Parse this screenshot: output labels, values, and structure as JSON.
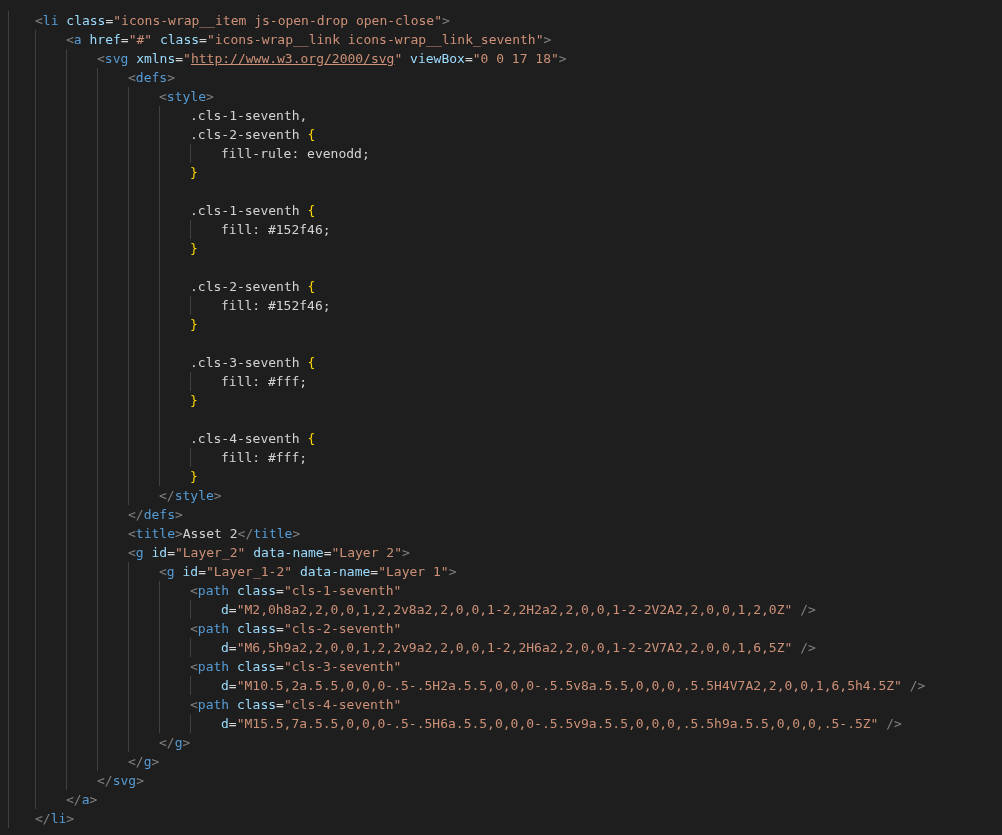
{
  "editor": {
    "lines": [
      {
        "kind": "code",
        "tokens": [
          {
            "kind": "bracket",
            "text": "<"
          },
          {
            "kind": "tag",
            "text": "li"
          },
          {
            "kind": "attr",
            "text": " class"
          },
          {
            "kind": "text",
            "text": "="
          },
          {
            "kind": "string",
            "text": "\"icons-wrap__item js-open-drop open-close\""
          },
          {
            "kind": "bracket",
            "text": ">"
          }
        ],
        "children": [
          {
            "kind": "code",
            "tokens": [
              {
                "kind": "bracket",
                "text": "<"
              },
              {
                "kind": "tag",
                "text": "a"
              },
              {
                "kind": "attr",
                "text": " href"
              },
              {
                "kind": "text",
                "text": "="
              },
              {
                "kind": "string",
                "text": "\"#\""
              },
              {
                "kind": "attr",
                "text": " class"
              },
              {
                "kind": "text",
                "text": "="
              },
              {
                "kind": "string",
                "text": "\"icons-wrap__link icons-wrap__link_seventh\""
              },
              {
                "kind": "bracket",
                "text": ">"
              }
            ],
            "children": [
              {
                "kind": "code",
                "tokens": [
                  {
                    "kind": "bracket",
                    "text": "<"
                  },
                  {
                    "kind": "tag",
                    "text": "svg"
                  },
                  {
                    "kind": "attr",
                    "text": " xmlns"
                  },
                  {
                    "kind": "text",
                    "text": "="
                  },
                  {
                    "kind": "string",
                    "text": "\""
                  },
                  {
                    "kind": "link",
                    "text": "http://www.w3.org/2000/svg"
                  },
                  {
                    "kind": "string",
                    "text": "\""
                  },
                  {
                    "kind": "attr",
                    "text": " viewBox"
                  },
                  {
                    "kind": "text",
                    "text": "="
                  },
                  {
                    "kind": "string",
                    "text": "\"0 0 17 18\""
                  },
                  {
                    "kind": "bracket",
                    "text": ">"
                  }
                ],
                "children": [
                  {
                    "kind": "code",
                    "tokens": [
                      {
                        "kind": "bracket",
                        "text": "<"
                      },
                      {
                        "kind": "tag",
                        "text": "defs"
                      },
                      {
                        "kind": "bracket",
                        "text": ">"
                      }
                    ],
                    "children": [
                      {
                        "kind": "code",
                        "tokens": [
                          {
                            "kind": "bracket",
                            "text": "<"
                          },
                          {
                            "kind": "tag",
                            "text": "style"
                          },
                          {
                            "kind": "bracket",
                            "text": ">"
                          }
                        ],
                        "children": [
                          {
                            "kind": "code",
                            "tokens": [
                              {
                                "kind": "text",
                                "text": ".cls-1-seventh,"
                              }
                            ]
                          },
                          {
                            "kind": "code",
                            "tokens": [
                              {
                                "kind": "text",
                                "text": ".cls-2-seventh "
                              },
                              {
                                "kind": "brace",
                                "text": "{"
                              }
                            ],
                            "children": [
                              {
                                "kind": "code",
                                "tokens": [
                                  {
                                    "kind": "text",
                                    "text": "fill-rule: evenodd;"
                                  }
                                ]
                              }
                            ]
                          },
                          {
                            "kind": "code",
                            "tokens": [
                              {
                                "kind": "brace",
                                "text": "}"
                              }
                            ]
                          },
                          {
                            "kind": "blank"
                          },
                          {
                            "kind": "code",
                            "tokens": [
                              {
                                "kind": "text",
                                "text": ".cls-1-seventh "
                              },
                              {
                                "kind": "brace",
                                "text": "{"
                              }
                            ],
                            "children": [
                              {
                                "kind": "code",
                                "tokens": [
                                  {
                                    "kind": "text",
                                    "text": "fill: #152f46;"
                                  }
                                ]
                              }
                            ]
                          },
                          {
                            "kind": "code",
                            "tokens": [
                              {
                                "kind": "brace",
                                "text": "}"
                              }
                            ]
                          },
                          {
                            "kind": "blank"
                          },
                          {
                            "kind": "code",
                            "tokens": [
                              {
                                "kind": "text",
                                "text": ".cls-2-seventh "
                              },
                              {
                                "kind": "brace",
                                "text": "{"
                              }
                            ],
                            "children": [
                              {
                                "kind": "code",
                                "tokens": [
                                  {
                                    "kind": "text",
                                    "text": "fill: #152f46;"
                                  }
                                ]
                              }
                            ]
                          },
                          {
                            "kind": "code",
                            "tokens": [
                              {
                                "kind": "brace",
                                "text": "}"
                              }
                            ]
                          },
                          {
                            "kind": "blank"
                          },
                          {
                            "kind": "code",
                            "tokens": [
                              {
                                "kind": "text",
                                "text": ".cls-3-seventh "
                              },
                              {
                                "kind": "brace",
                                "text": "{"
                              }
                            ],
                            "children": [
                              {
                                "kind": "code",
                                "tokens": [
                                  {
                                    "kind": "text",
                                    "text": "fill: #fff;"
                                  }
                                ]
                              }
                            ]
                          },
                          {
                            "kind": "code",
                            "tokens": [
                              {
                                "kind": "brace",
                                "text": "}"
                              }
                            ]
                          },
                          {
                            "kind": "blank"
                          },
                          {
                            "kind": "code",
                            "tokens": [
                              {
                                "kind": "text",
                                "text": ".cls-4-seventh "
                              },
                              {
                                "kind": "brace",
                                "text": "{"
                              }
                            ],
                            "children": [
                              {
                                "kind": "code",
                                "tokens": [
                                  {
                                    "kind": "text",
                                    "text": "fill: #fff;"
                                  }
                                ]
                              }
                            ]
                          },
                          {
                            "kind": "code",
                            "tokens": [
                              {
                                "kind": "brace",
                                "text": "}"
                              }
                            ]
                          }
                        ]
                      },
                      {
                        "kind": "code",
                        "tokens": [
                          {
                            "kind": "bracket",
                            "text": "</"
                          },
                          {
                            "kind": "tag",
                            "text": "style"
                          },
                          {
                            "kind": "bracket",
                            "text": ">"
                          }
                        ]
                      }
                    ]
                  },
                  {
                    "kind": "code",
                    "tokens": [
                      {
                        "kind": "bracket",
                        "text": "</"
                      },
                      {
                        "kind": "tag",
                        "text": "defs"
                      },
                      {
                        "kind": "bracket",
                        "text": ">"
                      }
                    ]
                  },
                  {
                    "kind": "code",
                    "tokens": [
                      {
                        "kind": "bracket",
                        "text": "<"
                      },
                      {
                        "kind": "tag",
                        "text": "title"
                      },
                      {
                        "kind": "bracket",
                        "text": ">"
                      },
                      {
                        "kind": "text",
                        "text": "Asset 2"
                      },
                      {
                        "kind": "bracket",
                        "text": "</"
                      },
                      {
                        "kind": "tag",
                        "text": "title"
                      },
                      {
                        "kind": "bracket",
                        "text": ">"
                      }
                    ]
                  },
                  {
                    "kind": "code",
                    "tokens": [
                      {
                        "kind": "bracket",
                        "text": "<"
                      },
                      {
                        "kind": "tag",
                        "text": "g"
                      },
                      {
                        "kind": "attr",
                        "text": " id"
                      },
                      {
                        "kind": "text",
                        "text": "="
                      },
                      {
                        "kind": "string",
                        "text": "\"Layer_2\""
                      },
                      {
                        "kind": "attr",
                        "text": " data-name"
                      },
                      {
                        "kind": "text",
                        "text": "="
                      },
                      {
                        "kind": "string",
                        "text": "\"Layer 2\""
                      },
                      {
                        "kind": "bracket",
                        "text": ">"
                      }
                    ],
                    "children": [
                      {
                        "kind": "code",
                        "tokens": [
                          {
                            "kind": "bracket",
                            "text": "<"
                          },
                          {
                            "kind": "tag",
                            "text": "g"
                          },
                          {
                            "kind": "attr",
                            "text": " id"
                          },
                          {
                            "kind": "text",
                            "text": "="
                          },
                          {
                            "kind": "string",
                            "text": "\"Layer_1-2\""
                          },
                          {
                            "kind": "attr",
                            "text": " data-name"
                          },
                          {
                            "kind": "text",
                            "text": "="
                          },
                          {
                            "kind": "string",
                            "text": "\"Layer 1\""
                          },
                          {
                            "kind": "bracket",
                            "text": ">"
                          }
                        ],
                        "children": [
                          {
                            "kind": "code",
                            "tokens": [
                              {
                                "kind": "bracket",
                                "text": "<"
                              },
                              {
                                "kind": "tag",
                                "text": "path"
                              },
                              {
                                "kind": "attr",
                                "text": " class"
                              },
                              {
                                "kind": "text",
                                "text": "="
                              },
                              {
                                "kind": "string",
                                "text": "\"cls-1-seventh\""
                              }
                            ],
                            "children": [
                              {
                                "kind": "code",
                                "tokens": [
                                  {
                                    "kind": "attr",
                                    "text": "d"
                                  },
                                  {
                                    "kind": "text",
                                    "text": "="
                                  },
                                  {
                                    "kind": "string",
                                    "text": "\"M2,0h8a2,2,0,0,1,2,2v8a2,2,0,0,1-2,2H2a2,2,0,0,1-2-2V2A2,2,0,0,1,2,0Z\""
                                  },
                                  {
                                    "kind": "bracket",
                                    "text": " />"
                                  }
                                ]
                              }
                            ]
                          },
                          {
                            "kind": "code",
                            "tokens": [
                              {
                                "kind": "bracket",
                                "text": "<"
                              },
                              {
                                "kind": "tag",
                                "text": "path"
                              },
                              {
                                "kind": "attr",
                                "text": " class"
                              },
                              {
                                "kind": "text",
                                "text": "="
                              },
                              {
                                "kind": "string",
                                "text": "\"cls-2-seventh\""
                              }
                            ],
                            "children": [
                              {
                                "kind": "code",
                                "tokens": [
                                  {
                                    "kind": "attr",
                                    "text": "d"
                                  },
                                  {
                                    "kind": "text",
                                    "text": "="
                                  },
                                  {
                                    "kind": "string",
                                    "text": "\"M6,5h9a2,2,0,0,1,2,2v9a2,2,0,0,1-2,2H6a2,2,0,0,1-2-2V7A2,2,0,0,1,6,5Z\""
                                  },
                                  {
                                    "kind": "bracket",
                                    "text": " />"
                                  }
                                ]
                              }
                            ]
                          },
                          {
                            "kind": "code",
                            "tokens": [
                              {
                                "kind": "bracket",
                                "text": "<"
                              },
                              {
                                "kind": "tag",
                                "text": "path"
                              },
                              {
                                "kind": "attr",
                                "text": " class"
                              },
                              {
                                "kind": "text",
                                "text": "="
                              },
                              {
                                "kind": "string",
                                "text": "\"cls-3-seventh\""
                              }
                            ],
                            "children": [
                              {
                                "kind": "code",
                                "tokens": [
                                  {
                                    "kind": "attr",
                                    "text": "d"
                                  },
                                  {
                                    "kind": "text",
                                    "text": "="
                                  },
                                  {
                                    "kind": "string",
                                    "text": "\"M10.5,2a.5.5,0,0,0-.5-.5H2a.5.5,0,0,0-.5.5v8a.5.5,0,0,0,.5.5H4V7A2,2,0,0,1,6,5h4.5Z\""
                                  },
                                  {
                                    "kind": "bracket",
                                    "text": " />"
                                  }
                                ]
                              }
                            ]
                          },
                          {
                            "kind": "code",
                            "tokens": [
                              {
                                "kind": "bracket",
                                "text": "<"
                              },
                              {
                                "kind": "tag",
                                "text": "path"
                              },
                              {
                                "kind": "attr",
                                "text": " class"
                              },
                              {
                                "kind": "text",
                                "text": "="
                              },
                              {
                                "kind": "string",
                                "text": "\"cls-4-seventh\""
                              }
                            ],
                            "children": [
                              {
                                "kind": "code",
                                "tokens": [
                                  {
                                    "kind": "attr",
                                    "text": "d"
                                  },
                                  {
                                    "kind": "text",
                                    "text": "="
                                  },
                                  {
                                    "kind": "string",
                                    "text": "\"M15.5,7a.5.5,0,0,0-.5-.5H6a.5.5,0,0,0-.5.5v9a.5.5,0,0,0,.5.5h9a.5.5,0,0,0,.5-.5Z\""
                                  },
                                  {
                                    "kind": "bracket",
                                    "text": " />"
                                  }
                                ]
                              }
                            ]
                          }
                        ]
                      },
                      {
                        "kind": "code",
                        "tokens": [
                          {
                            "kind": "bracket",
                            "text": "</"
                          },
                          {
                            "kind": "tag",
                            "text": "g"
                          },
                          {
                            "kind": "bracket",
                            "text": ">"
                          }
                        ]
                      }
                    ]
                  },
                  {
                    "kind": "code",
                    "tokens": [
                      {
                        "kind": "bracket",
                        "text": "</"
                      },
                      {
                        "kind": "tag",
                        "text": "g"
                      },
                      {
                        "kind": "bracket",
                        "text": ">"
                      }
                    ]
                  }
                ]
              },
              {
                "kind": "code",
                "tokens": [
                  {
                    "kind": "bracket",
                    "text": "</"
                  },
                  {
                    "kind": "tag",
                    "text": "svg"
                  },
                  {
                    "kind": "bracket",
                    "text": ">"
                  }
                ]
              }
            ]
          },
          {
            "kind": "code",
            "tokens": [
              {
                "kind": "bracket",
                "text": "</"
              },
              {
                "kind": "tag",
                "text": "a"
              },
              {
                "kind": "bracket",
                "text": ">"
              }
            ]
          }
        ]
      },
      {
        "kind": "code",
        "tokens": [
          {
            "kind": "bracket",
            "text": "</"
          },
          {
            "kind": "tag",
            "text": "li"
          },
          {
            "kind": "bracket",
            "text": ">"
          }
        ]
      }
    ]
  }
}
